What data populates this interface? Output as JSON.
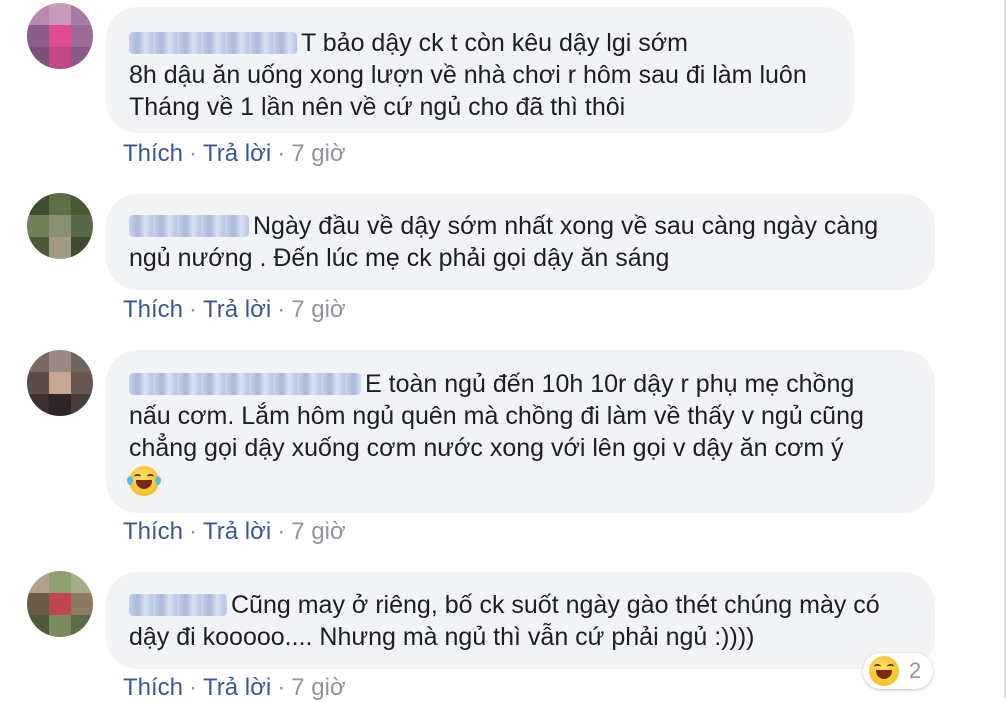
{
  "comments": [
    {
      "lines": [
        "T bảo dậy ck t còn kêu dậy lgi sớm",
        "8h dậu ăn uống xong lượn về nhà chơi r hôm sau đi làm luôn",
        "Tháng về 1 lần nên về cứ ngủ cho đã thì thôi"
      ],
      "actions": {
        "like": "Thích",
        "reply": "Trả lời",
        "time": "7 giờ"
      }
    },
    {
      "lines": [
        "Ngày đầu về dậy sớm nhất xong về sau càng ngày càng",
        "ngủ nướng . Đến lúc mẹ ck phải gọi dậy ăn sáng"
      ],
      "actions": {
        "like": "Thích",
        "reply": "Trả lời",
        "time": "7 giờ"
      }
    },
    {
      "lines": [
        "E toàn ngủ đến 10h 10r dậy r phụ mẹ chồng",
        "nấu cơm. Lắm hôm ngủ quên mà chồng đi làm về thấy v ngủ cũng",
        "chẳng gọi dậy xuống cơm nước xong với lên gọi v dậy ăn cơm ý"
      ],
      "emoji": "laughing-tears-icon",
      "actions": {
        "like": "Thích",
        "reply": "Trả lời",
        "time": "7 giờ"
      }
    },
    {
      "lines": [
        "Cũng may ở riêng, bố ck suốt ngày gào thét chúng mày có",
        "dậy đi kooooo.... Nhưng mà ngủ thì vẫn cứ phải ngủ :))))"
      ],
      "actions": {
        "like": "Thích",
        "reply": "Trả lời",
        "time": "7 giờ"
      }
    }
  ],
  "separator": "·",
  "reaction": {
    "icon": "haha-reaction-icon",
    "count": "2"
  },
  "colors": {
    "link": "#385898",
    "muted": "#90949c",
    "bubble": "#f2f3f5",
    "text": "#1c1e21"
  }
}
